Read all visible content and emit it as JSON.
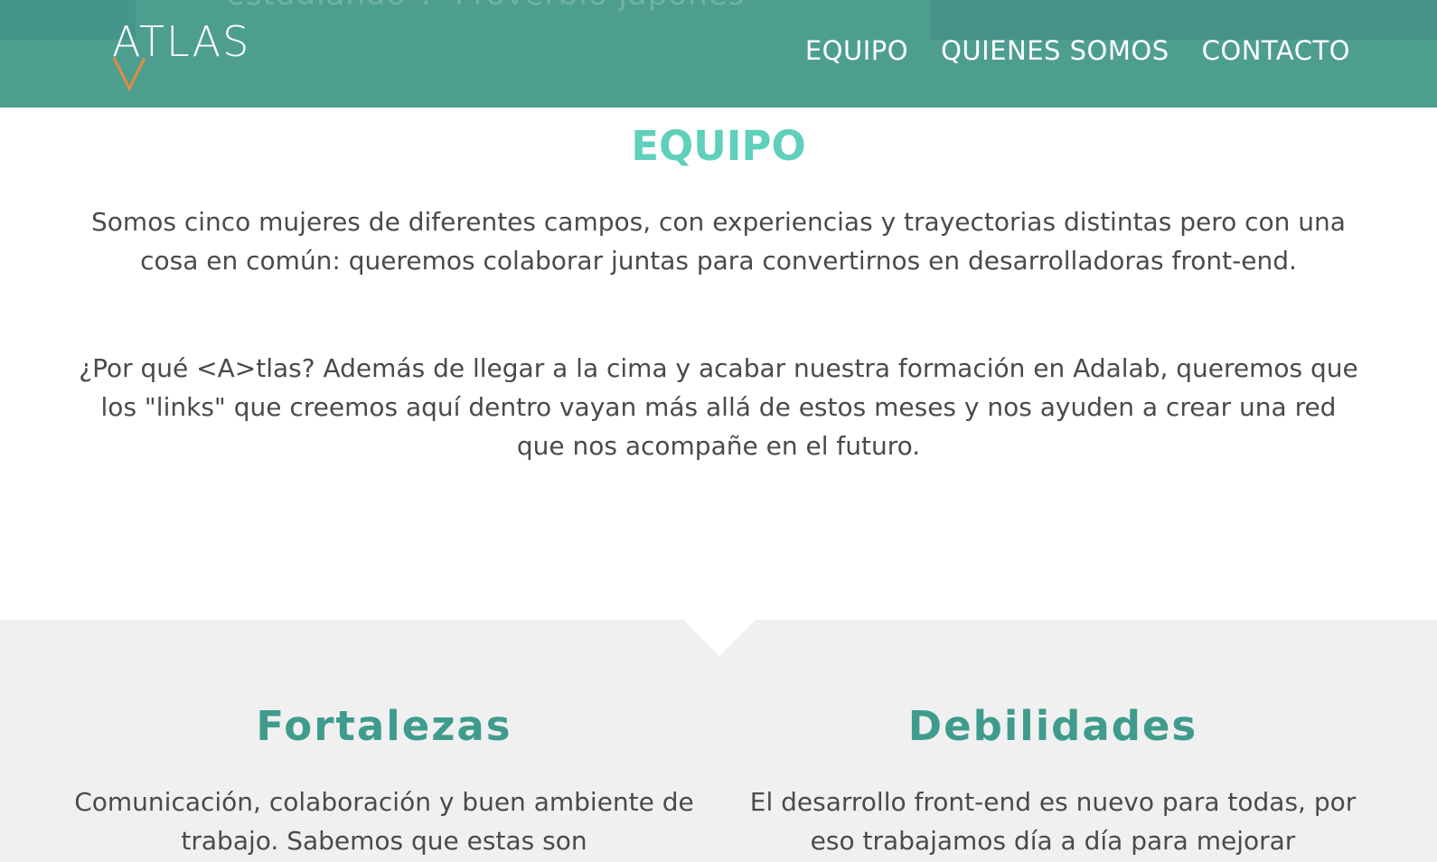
{
  "header": {
    "background_text": "estudiando\". -Proverbio japonés",
    "logo": {
      "text": "ATLAS",
      "accent_color": "#e38b3d"
    },
    "nav": [
      {
        "label": "EQUIPO"
      },
      {
        "label": "QUIENES SOMOS"
      },
      {
        "label": "CONTACTO"
      }
    ],
    "color": "#4e9e90"
  },
  "equipo": {
    "title": "EQUIPO",
    "paragraph_1": "Somos cinco mujeres de diferentes campos, con experiencias y trayectorias distintas pero con una cosa en común: queremos colaborar juntas para convertirnos en desarrolladoras front-end.",
    "paragraph_2": "¿Por qué <A>tlas? Además de llegar a la cima y acabar nuestra formación en Adalab, queremos que los \"links\" que creemos aquí dentro vayan más allá de estos meses y nos ayuden a crear una red que nos acompañe en el futuro.",
    "title_color": "#5fd0bb"
  },
  "analysis": {
    "strengths": {
      "title": "Fortalezas",
      "text": "Comunicación, colaboración y buen ambiente de trabajo. Sabemos que estas son"
    },
    "weaknesses": {
      "title": "Debilidades",
      "text": "El desarrollo front-end es nuevo para todas, por eso trabajamos día a día para mejorar"
    },
    "title_color": "#3f9c8d",
    "background": "#f0f0f0"
  }
}
